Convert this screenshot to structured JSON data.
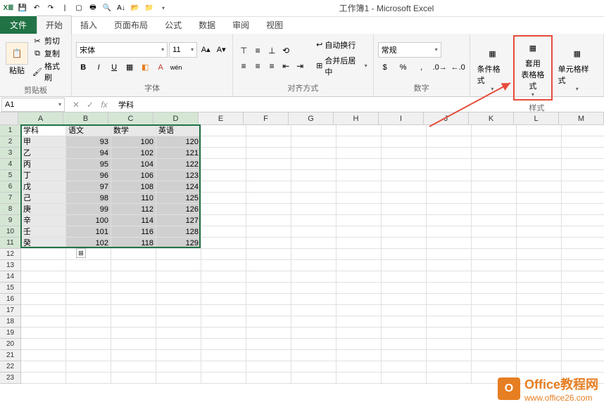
{
  "title": "工作簿1 - Microsoft Excel",
  "tabs": {
    "file": "文件",
    "home": "开始",
    "insert": "插入",
    "layout": "页面布局",
    "formulas": "公式",
    "data": "数据",
    "review": "审阅",
    "view": "视图"
  },
  "clipboard": {
    "paste": "粘贴",
    "cut": "剪切",
    "copy": "复制",
    "painter": "格式刷",
    "label": "剪贴板"
  },
  "font": {
    "name": "宋体",
    "size": "11",
    "label": "字体",
    "bold": "B",
    "italic": "I",
    "underline": "U"
  },
  "alignment": {
    "label": "对齐方式",
    "wrap": "自动换行",
    "merge": "合并后居中"
  },
  "number": {
    "format": "常规",
    "label": "数字"
  },
  "styles": {
    "conditional": "条件格式",
    "table": "套用\n表格格式",
    "cell": "单元格样式",
    "label": "样式"
  },
  "namebox": "A1",
  "formula_value": "学科",
  "columns": [
    "A",
    "B",
    "C",
    "D",
    "E",
    "F",
    "G",
    "H",
    "I",
    "J",
    "K",
    "L",
    "M"
  ],
  "row_count": 23,
  "data_rows": [
    {
      "a": "学科",
      "b": "语文",
      "c": "数学",
      "d": "英语"
    },
    {
      "a": "甲",
      "b": "93",
      "c": "100",
      "d": "120"
    },
    {
      "a": "乙",
      "b": "94",
      "c": "102",
      "d": "121"
    },
    {
      "a": "丙",
      "b": "95",
      "c": "104",
      "d": "122"
    },
    {
      "a": "丁",
      "b": "96",
      "c": "106",
      "d": "123"
    },
    {
      "a": "戊",
      "b": "97",
      "c": "108",
      "d": "124"
    },
    {
      "a": "己",
      "b": "98",
      "c": "110",
      "d": "125"
    },
    {
      "a": "庚",
      "b": "99",
      "c": "112",
      "d": "126"
    },
    {
      "a": "辛",
      "b": "100",
      "c": "114",
      "d": "127"
    },
    {
      "a": "壬",
      "b": "101",
      "c": "116",
      "d": "128"
    },
    {
      "a": "癸",
      "b": "102",
      "c": "118",
      "d": "129"
    }
  ],
  "watermark": {
    "title": "Office教程网",
    "url": "www.office26.com",
    "logo": "O"
  }
}
